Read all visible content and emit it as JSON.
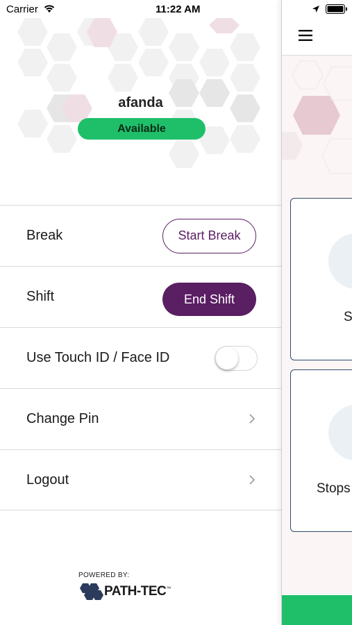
{
  "status_bar": {
    "carrier": "Carrier",
    "time": "11:22 AM"
  },
  "profile": {
    "name": "afanda",
    "status": "Available"
  },
  "menu": {
    "break_label": "Break",
    "break_button": "Start Break",
    "shift_label": "Shift",
    "shift_button": "End Shift",
    "biometric_label": "Use Touch ID / Face ID",
    "biometric_enabled": false,
    "change_pin_label": "Change Pin",
    "logout_label": "Logout"
  },
  "footer": {
    "powered_by": "POWERED BY:",
    "brand": "PATH-TEC",
    "trademark": "™"
  },
  "main_peek": {
    "card1_text": "S",
    "card2_text": "Stops"
  },
  "colors": {
    "accent_purple": "#5a1e63",
    "status_green": "#1fbf6a",
    "card_border": "#2e4a6e"
  }
}
